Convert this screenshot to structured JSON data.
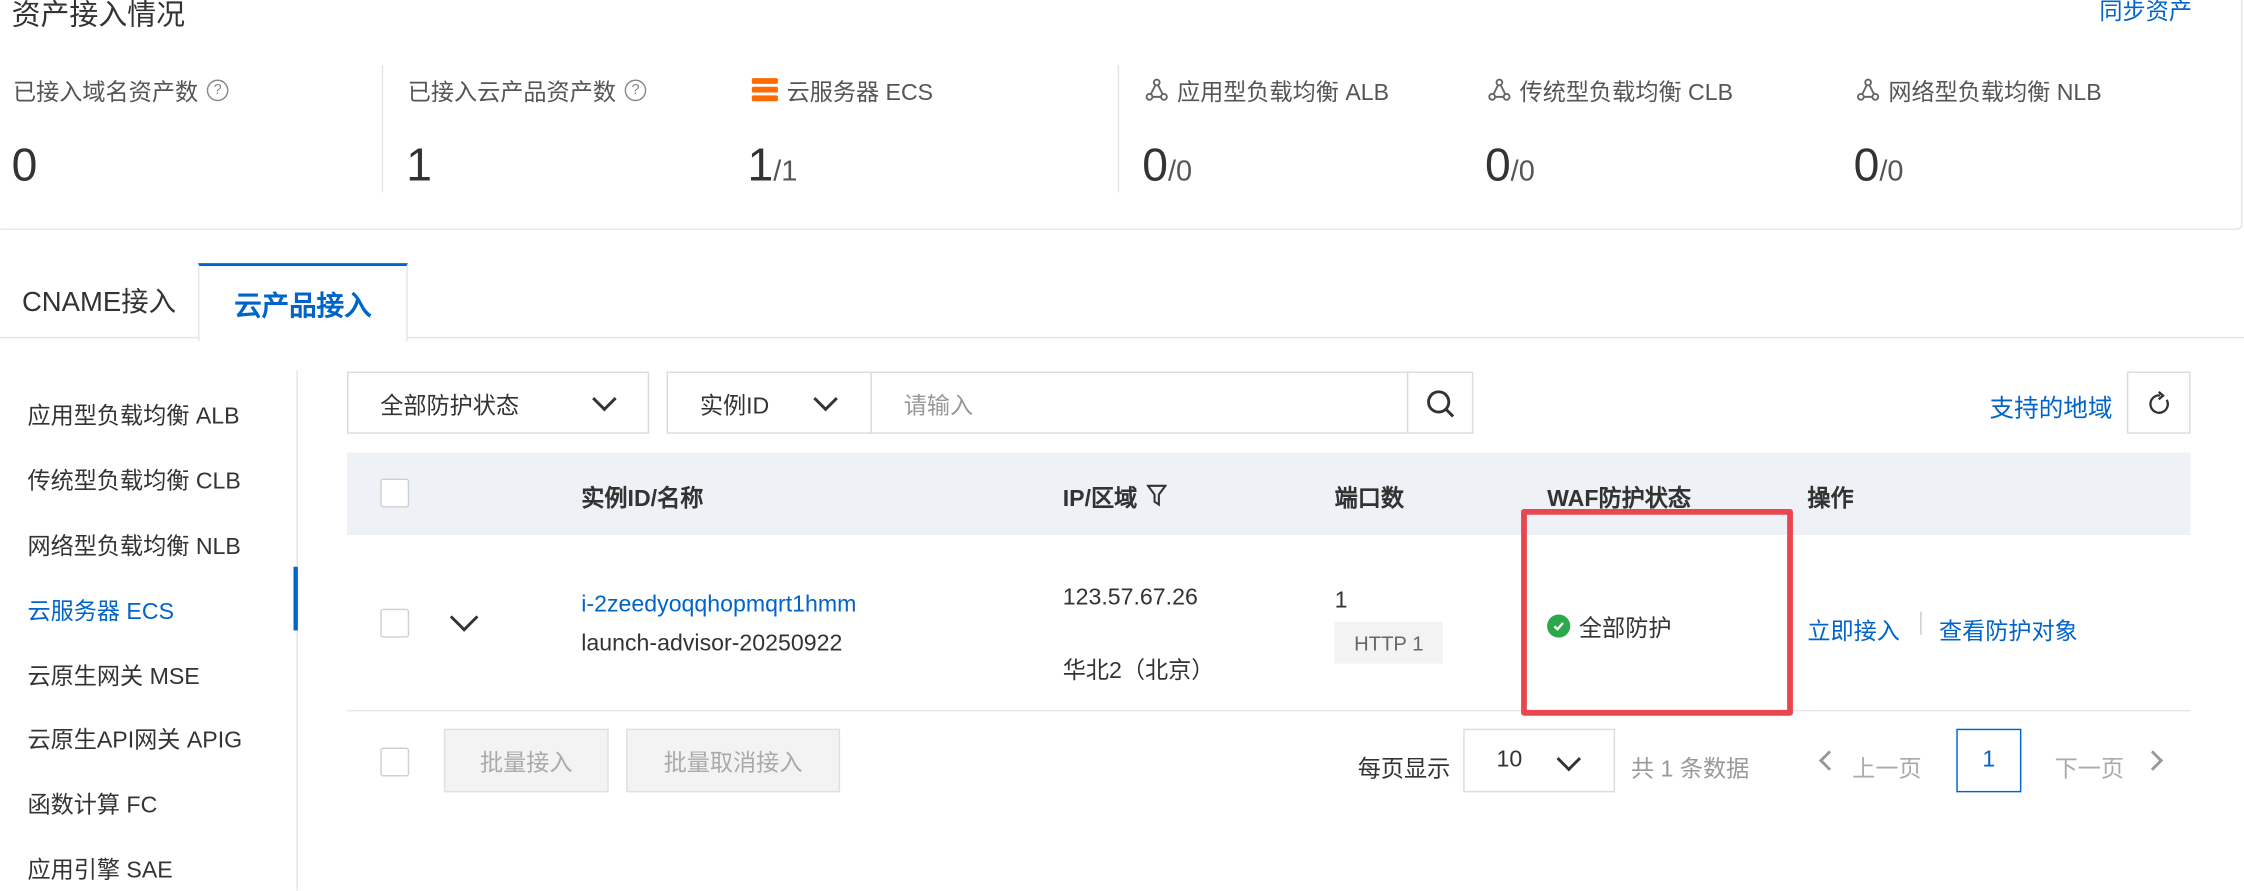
{
  "summary": {
    "title": "资产接入情况",
    "sync_label": "同步资产",
    "stats": [
      {
        "label": "已接入域名资产数",
        "value": "0",
        "total": ""
      },
      {
        "label": "已接入云产品资产数",
        "value": "1",
        "total": ""
      },
      {
        "label": "云服务器 ECS",
        "value": "1",
        "total": "/1"
      },
      {
        "label": "应用型负载均衡 ALB",
        "value": "0",
        "total": "/0"
      },
      {
        "label": "传统型负载均衡 CLB",
        "value": "0",
        "total": "/0"
      },
      {
        "label": "网络型负载均衡 NLB",
        "value": "0",
        "total": "/0"
      }
    ],
    "help_glyph": "?"
  },
  "tabs": [
    {
      "label": "CNAME接入"
    },
    {
      "label": "云产品接入"
    }
  ],
  "sidebar": {
    "items": [
      {
        "label": "应用型负载均衡 ALB"
      },
      {
        "label": "传统型负载均衡 CLB"
      },
      {
        "label": "网络型负载均衡 NLB"
      },
      {
        "label": "云服务器 ECS"
      },
      {
        "label": "云原生网关 MSE"
      },
      {
        "label": "云原生API网关 APIG"
      },
      {
        "label": "函数计算 FC"
      },
      {
        "label": "应用引擎 SAE"
      }
    ],
    "active_index": 3
  },
  "filters": {
    "status_select": "全部防护状态",
    "field_select": "实例ID",
    "search_placeholder": "请输入",
    "region_link": "支持的地域"
  },
  "table": {
    "headers": [
      "实例ID/名称",
      "IP/区域",
      "端口数",
      "WAF防护状态",
      "操作"
    ],
    "rows": [
      {
        "instance_id": "i-2zeedyoqqhopmqrt1hmm",
        "instance_name": "launch-advisor-20250922",
        "ip": "123.57.67.26",
        "region": "华北2（北京）",
        "port_count": "1",
        "port_tag": "HTTP 1",
        "waf_status": "全部防护",
        "actions": [
          "立即接入",
          "查看防护对象"
        ]
      }
    ]
  },
  "footer": {
    "batch_connect": "批量接入",
    "batch_cancel": "批量取消接入",
    "page_size_label": "每页显示",
    "page_size": "10",
    "total_text": "共 1 条数据",
    "prev": "上一页",
    "current_page": "1",
    "next": "下一页"
  },
  "colors": {
    "accent": "#0064c8",
    "highlight_box": "#e8474f",
    "success": "#2aa84a",
    "ecs_icon": "#ff6a00"
  }
}
